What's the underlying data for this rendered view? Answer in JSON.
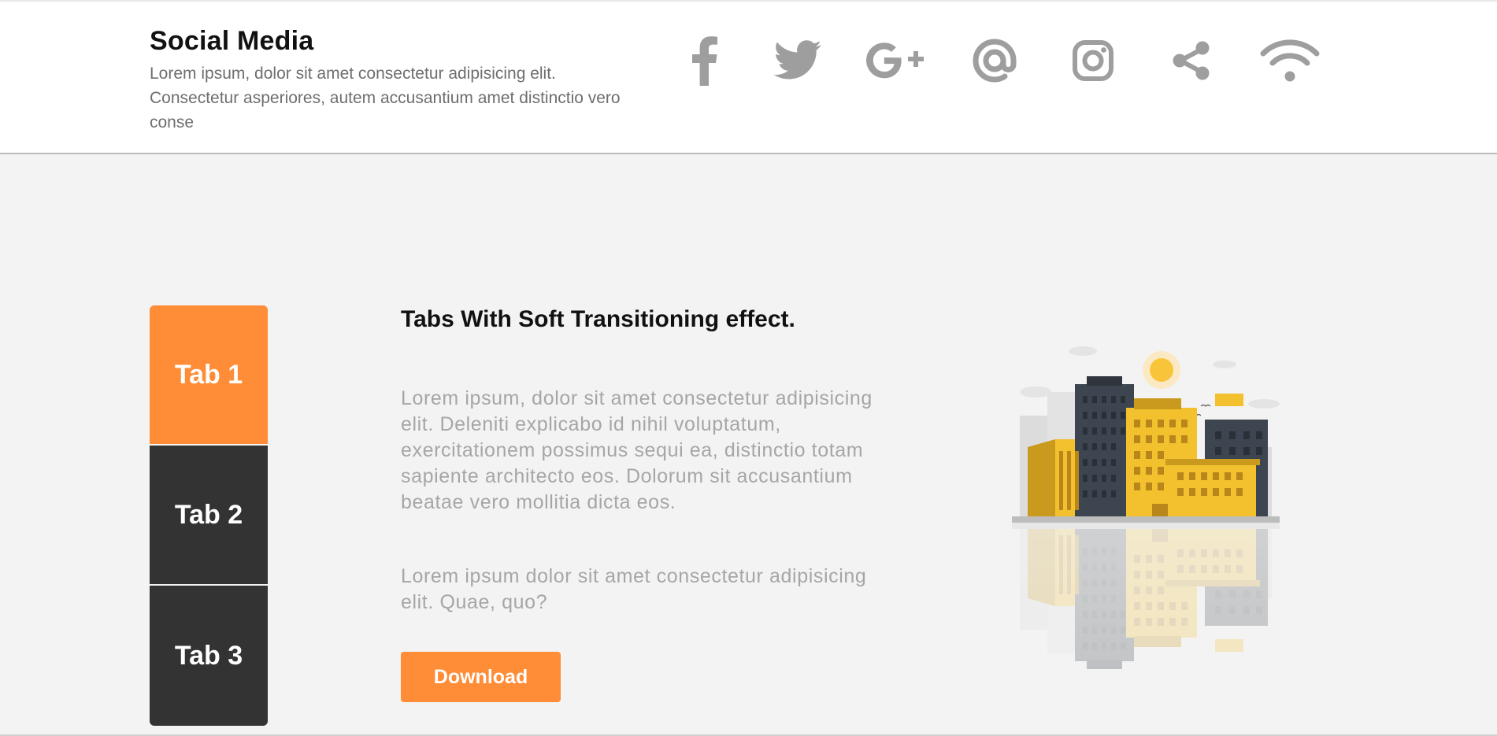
{
  "header": {
    "title": "Social Media",
    "description": "Lorem ipsum, dolor sit amet consectetur adipisicing elit. Consectetur asperiores, autem accusantium amet distinctio vero conse"
  },
  "social_icons": [
    {
      "name": "facebook-icon"
    },
    {
      "name": "twitter-icon"
    },
    {
      "name": "google-plus-icon"
    },
    {
      "name": "at-sign-icon"
    },
    {
      "name": "instagram-icon"
    },
    {
      "name": "share-icon"
    },
    {
      "name": "wifi-icon"
    }
  ],
  "tabs": [
    {
      "label": "Tab 1",
      "active": true
    },
    {
      "label": "Tab 2",
      "active": false
    },
    {
      "label": "Tab 3",
      "active": false
    }
  ],
  "content": {
    "title": "Tabs With Soft Transitioning effect.",
    "paragraph1": "Lorem ipsum, dolor sit amet consectetur adipisicing elit. Deleniti explicabo id nihil voluptatum, exercitationem possimus sequi ea, distinctio totam sapiente architecto eos. Dolorum sit accusantium beatae vero mollitia dicta eos.",
    "paragraph2": "Lorem ipsum dolor sit amet consectetur adipisicing elit. Quae, quo?",
    "download_label": "Download"
  },
  "colors": {
    "accent": "#ff8c36",
    "tab_dark": "#333333",
    "icon_gray": "#9e9e9e",
    "background": "#f3f3f3"
  }
}
